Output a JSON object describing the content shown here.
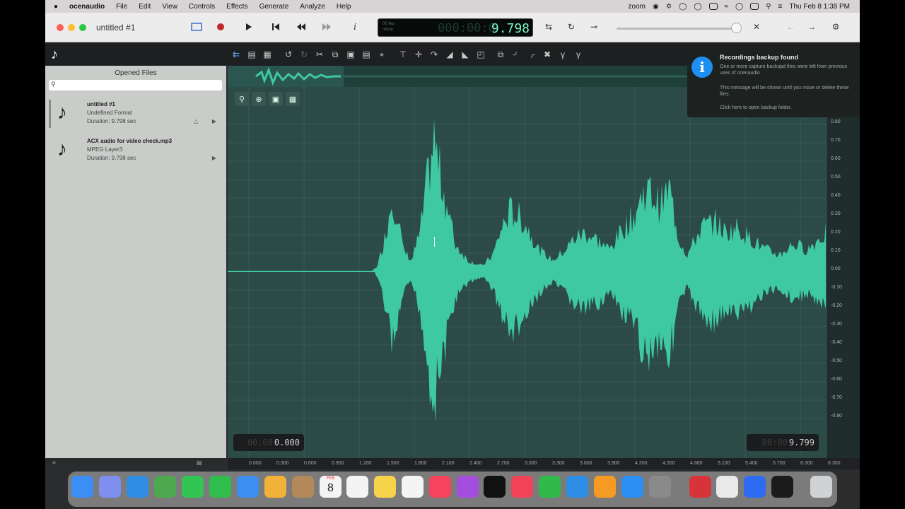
{
  "menubar": {
    "apple": "",
    "app_name": "ocenaudio",
    "items": [
      "File",
      "Edit",
      "View",
      "Controls",
      "Effects",
      "Generate",
      "Analyze",
      "Help"
    ],
    "zoom": "zoom",
    "datetime": "Thu Feb 8  1:38 PM"
  },
  "window": {
    "title": "untitled #1"
  },
  "lcd": {
    "label_top": "00 feu",
    "label_bottom": "mono",
    "dim": "000:00:0",
    "time": "9.798"
  },
  "sidebar": {
    "title": "Opened Files",
    "search_placeholder": "",
    "files": [
      {
        "name": "untitled #1",
        "format": "Undefined Format",
        "duration": "Duration: 9.798 sec"
      },
      {
        "name": "ACX audio for video check.mp3",
        "format": "MPEG Layer3",
        "duration": "Duration: 9.798 sec"
      }
    ]
  },
  "notification": {
    "title": "Recordings backup found",
    "line1": "One or more capture backupd files were left from previous uses of ocenaudio",
    "line2": "This message will be shown until you move or delete these files.",
    "line3": "Click here to open backup folder."
  },
  "waveform": {
    "start_time": "0.000",
    "end_time": "9.799",
    "start_ghost": "00:00",
    "end_ghost": "00:00",
    "y_ticks": [
      "0.80",
      "0.70",
      "0.60",
      "0.50",
      "0.40",
      "0.30",
      "0.20",
      "0.10",
      "0.00",
      "0.10",
      "0.20",
      "0.30",
      "0.40",
      "0.50",
      "0.60",
      "0.70",
      "0.80"
    ],
    "x_ticks": [
      "0.000",
      "0.300",
      "0.600",
      "0.900",
      "1.200",
      "1.500",
      "1.800",
      "2.100",
      "2.400",
      "2.700",
      "3.000",
      "3.300",
      "3.600",
      "3.900",
      "4.200",
      "4.500",
      "4.800",
      "5.100",
      "5.400",
      "5.700",
      "6.000",
      "6.300"
    ]
  },
  "dock": {
    "calendar_month": "FEB",
    "calendar_day": "8"
  },
  "colors": {
    "wave": "#3ec9a3",
    "wave_bg": "#2c4a46",
    "accent": "#1e8ef1"
  }
}
